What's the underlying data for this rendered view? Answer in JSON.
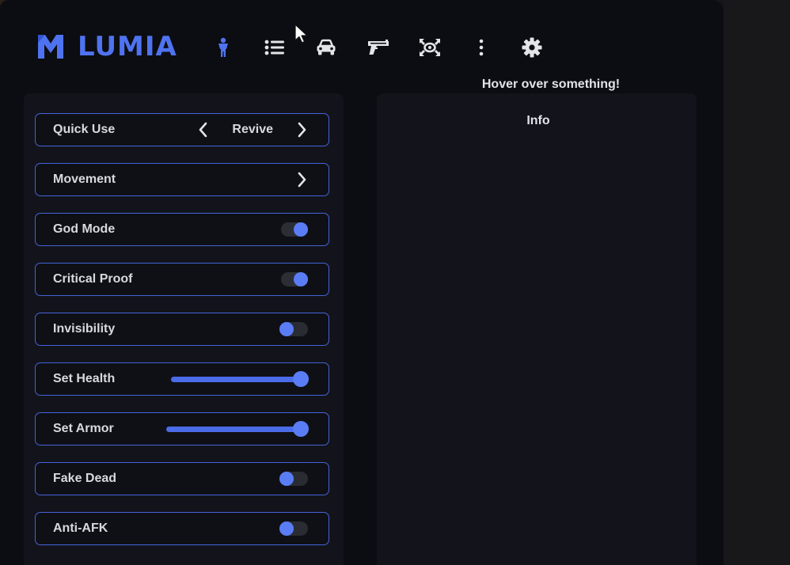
{
  "app": {
    "brand": "LUMIA",
    "accent_color": "#4f73f0"
  },
  "nav": {
    "items": [
      {
        "icon": "person-icon",
        "active": true
      },
      {
        "icon": "list-icon",
        "active": false
      },
      {
        "icon": "car-icon",
        "active": false
      },
      {
        "icon": "gun-icon",
        "active": false
      },
      {
        "icon": "teleport-icon",
        "active": false
      },
      {
        "icon": "more-vertical-icon",
        "active": false
      },
      {
        "icon": "gear-icon",
        "active": false
      }
    ]
  },
  "hover_hint": "Hover over something!",
  "menu": {
    "quick_use": {
      "label": "Quick Use",
      "value": "Revive"
    },
    "movement": {
      "label": "Movement"
    },
    "god_mode": {
      "label": "God Mode",
      "enabled": true
    },
    "critical_proof": {
      "label": "Critical Proof",
      "enabled": true
    },
    "invisibility": {
      "label": "Invisibility",
      "enabled": false
    },
    "set_health": {
      "label": "Set Health",
      "value_percent": 100
    },
    "set_armor": {
      "label": "Set Armor",
      "value_percent": 100
    },
    "fake_dead": {
      "label": "Fake Dead",
      "enabled": false
    },
    "anti_afk": {
      "label": "Anti-AFK",
      "enabled": false
    }
  },
  "info_panel": {
    "title": "Info"
  }
}
